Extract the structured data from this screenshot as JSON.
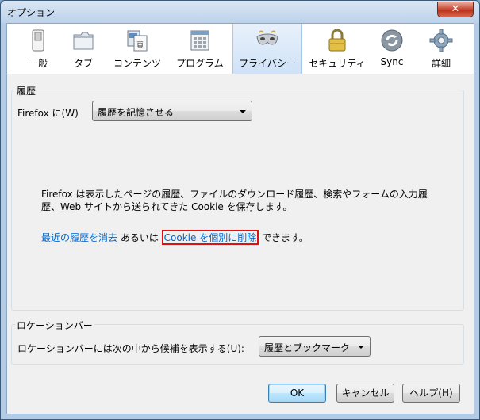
{
  "window": {
    "title": "オプション",
    "close_label": "✕"
  },
  "toolbar": {
    "items": [
      {
        "label": "一般",
        "icon": "switch-icon"
      },
      {
        "label": "タブ",
        "icon": "tab-folder-icon"
      },
      {
        "label": "コンテンツ",
        "icon": "content-page-icon"
      },
      {
        "label": "プログラム",
        "icon": "applications-icon"
      },
      {
        "label": "プライバシー",
        "icon": "privacy-mask-icon",
        "selected": true
      },
      {
        "label": "セキュリティ",
        "icon": "lock-icon"
      },
      {
        "label": "Sync",
        "icon": "sync-icon"
      },
      {
        "label": "詳細",
        "icon": "gear-icon"
      }
    ]
  },
  "history": {
    "title": "履歴",
    "firefox_label": "Firefox に(W)",
    "mode_value": "履歴を記憶させる",
    "description_line1": "Firefox は表示したページの履歴、ファイルのダウンロード履歴、検索やフォームの入力履",
    "description_line2": "歴、Web サイトから送られてきた Cookie を保存します。",
    "clear_recent_link": "最近の履歴を消去",
    "or_text": " あるいは ",
    "remove_cookies_link": "Cookie を個別に削除",
    "tail_text": " できます。"
  },
  "locationbar": {
    "title": "ロケーションバー",
    "suggest_label": "ロケーションバーには次の中から候補を表示する(U):",
    "suggest_value": "履歴とブックマーク"
  },
  "buttons": {
    "ok": "OK",
    "cancel": "キャンセル",
    "help": "ヘルプ(H)"
  },
  "colors": {
    "link": "#0066cc",
    "highlight": "#e01010",
    "selected_tab": "#cfe2f7"
  }
}
